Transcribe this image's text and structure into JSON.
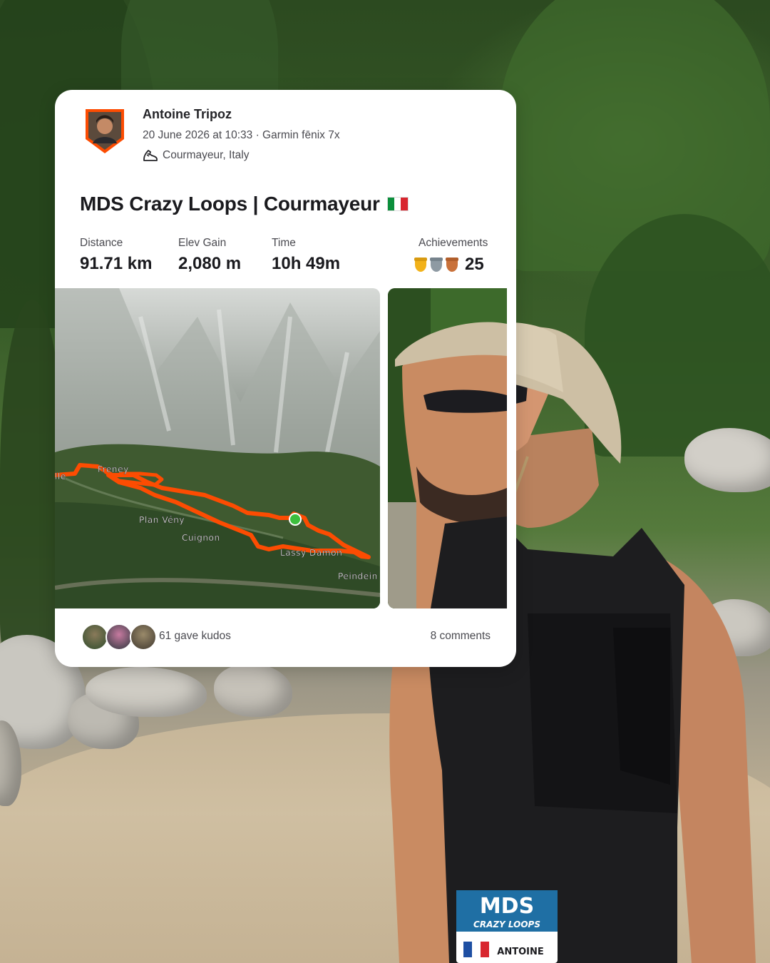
{
  "activity": {
    "athlete_name": "Antoine Tripoz",
    "date_device": "20 June 2026 at 10:33 · Garmin fēnix 7x",
    "location": "Courmayeur, Italy",
    "title": "MDS Crazy Loops | Courmayeur",
    "title_flag": "italy-flag"
  },
  "stats": {
    "distance_label": "Distance",
    "distance_value": "91.71 km",
    "elev_label": "Elev Gain",
    "elev_value": "2,080 m",
    "time_label": "Time",
    "time_value": "10h 49m",
    "achievements_label": "Achievements",
    "achievements_count": "25",
    "trophy_colors": [
      "#f2b21a",
      "#8e9aa3",
      "#c9713a"
    ]
  },
  "map": {
    "route_color": "#fc4c02",
    "labels": {
      "l1": "lle",
      "l2": "Freney",
      "l3": "Plan Vény",
      "l4": "Cuignon",
      "l5": "Lassy Damon",
      "l6": "Peindein"
    }
  },
  "social": {
    "kudos": "61 gave kudos",
    "comments": "8 comments"
  },
  "bib": {
    "brand": "MDS",
    "event": "CRAZY LOOPS",
    "name": "ANTOINE"
  },
  "colors": {
    "accent": "#fc4c02",
    "card_bg": "#ffffff",
    "text_primary": "#1a1a1e",
    "text_secondary": "#4a4a50"
  }
}
